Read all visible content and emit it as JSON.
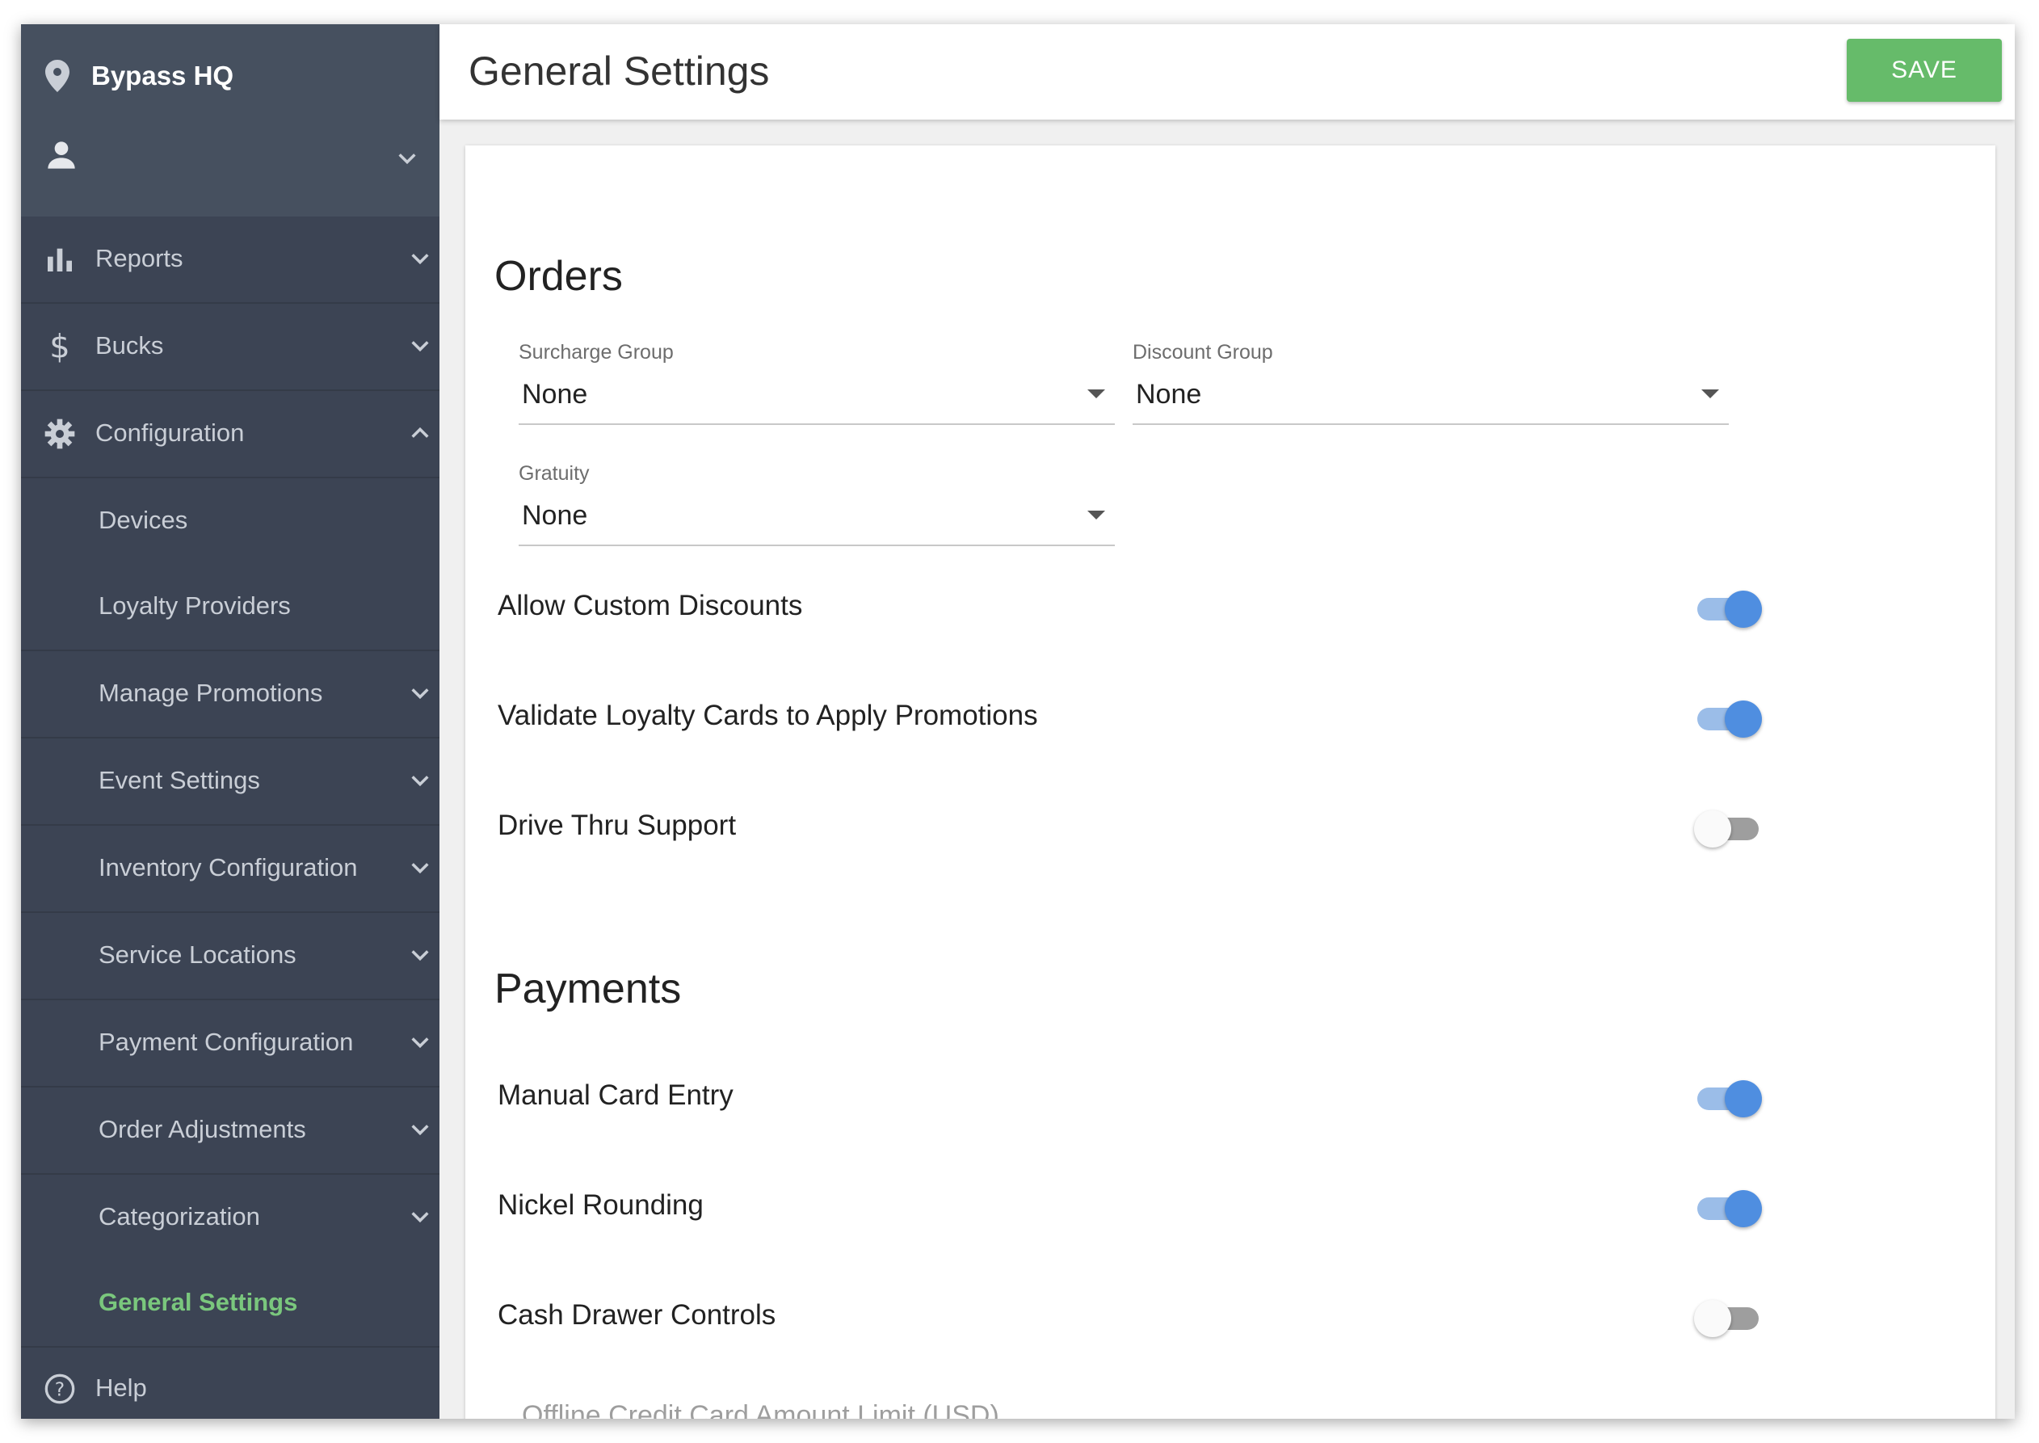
{
  "sidebar": {
    "location": "Bypass HQ",
    "items": [
      {
        "label": "Reports",
        "icon": "bar-chart-icon",
        "chevron": "down"
      },
      {
        "label": "Bucks",
        "icon": "dollar-icon",
        "chevron": "down"
      },
      {
        "label": "Configuration",
        "icon": "gear-icon",
        "chevron": "up"
      },
      {
        "label": "Devices"
      },
      {
        "label": "Loyalty Providers"
      },
      {
        "label": "Manage Promotions",
        "chevron": "down"
      },
      {
        "label": "Event Settings",
        "chevron": "down"
      },
      {
        "label": "Inventory Configuration",
        "chevron": "down"
      },
      {
        "label": "Service Locations",
        "chevron": "down"
      },
      {
        "label": "Payment Configuration",
        "chevron": "down"
      },
      {
        "label": "Order Adjustments",
        "chevron": "down"
      },
      {
        "label": "Categorization",
        "chevron": "down"
      },
      {
        "label": "General Settings",
        "active": true
      },
      {
        "label": "Help",
        "icon": "help-icon"
      }
    ]
  },
  "header": {
    "title": "General Settings",
    "save_label": "SAVE"
  },
  "orders": {
    "title": "Orders",
    "surcharge": {
      "label": "Surcharge Group",
      "value": "None"
    },
    "discount": {
      "label": "Discount Group",
      "value": "None"
    },
    "gratuity": {
      "label": "Gratuity",
      "value": "None"
    },
    "toggles": [
      {
        "label": "Allow Custom Discounts",
        "on": true
      },
      {
        "label": "Validate Loyalty Cards to Apply Promotions",
        "on": true
      },
      {
        "label": "Drive Thru Support",
        "on": false
      }
    ]
  },
  "payments": {
    "title": "Payments",
    "toggles": [
      {
        "label": "Manual Card Entry",
        "on": true
      },
      {
        "label": "Nickel Rounding",
        "on": true
      },
      {
        "label": "Cash Drawer Controls",
        "on": false
      }
    ],
    "offline_label": "Offline Credit Card Amount Limit (USD)"
  },
  "colors": {
    "sidebar": "#3c4454",
    "accent_green": "#66bb6a",
    "toggle_on": "#4f8ee0"
  }
}
